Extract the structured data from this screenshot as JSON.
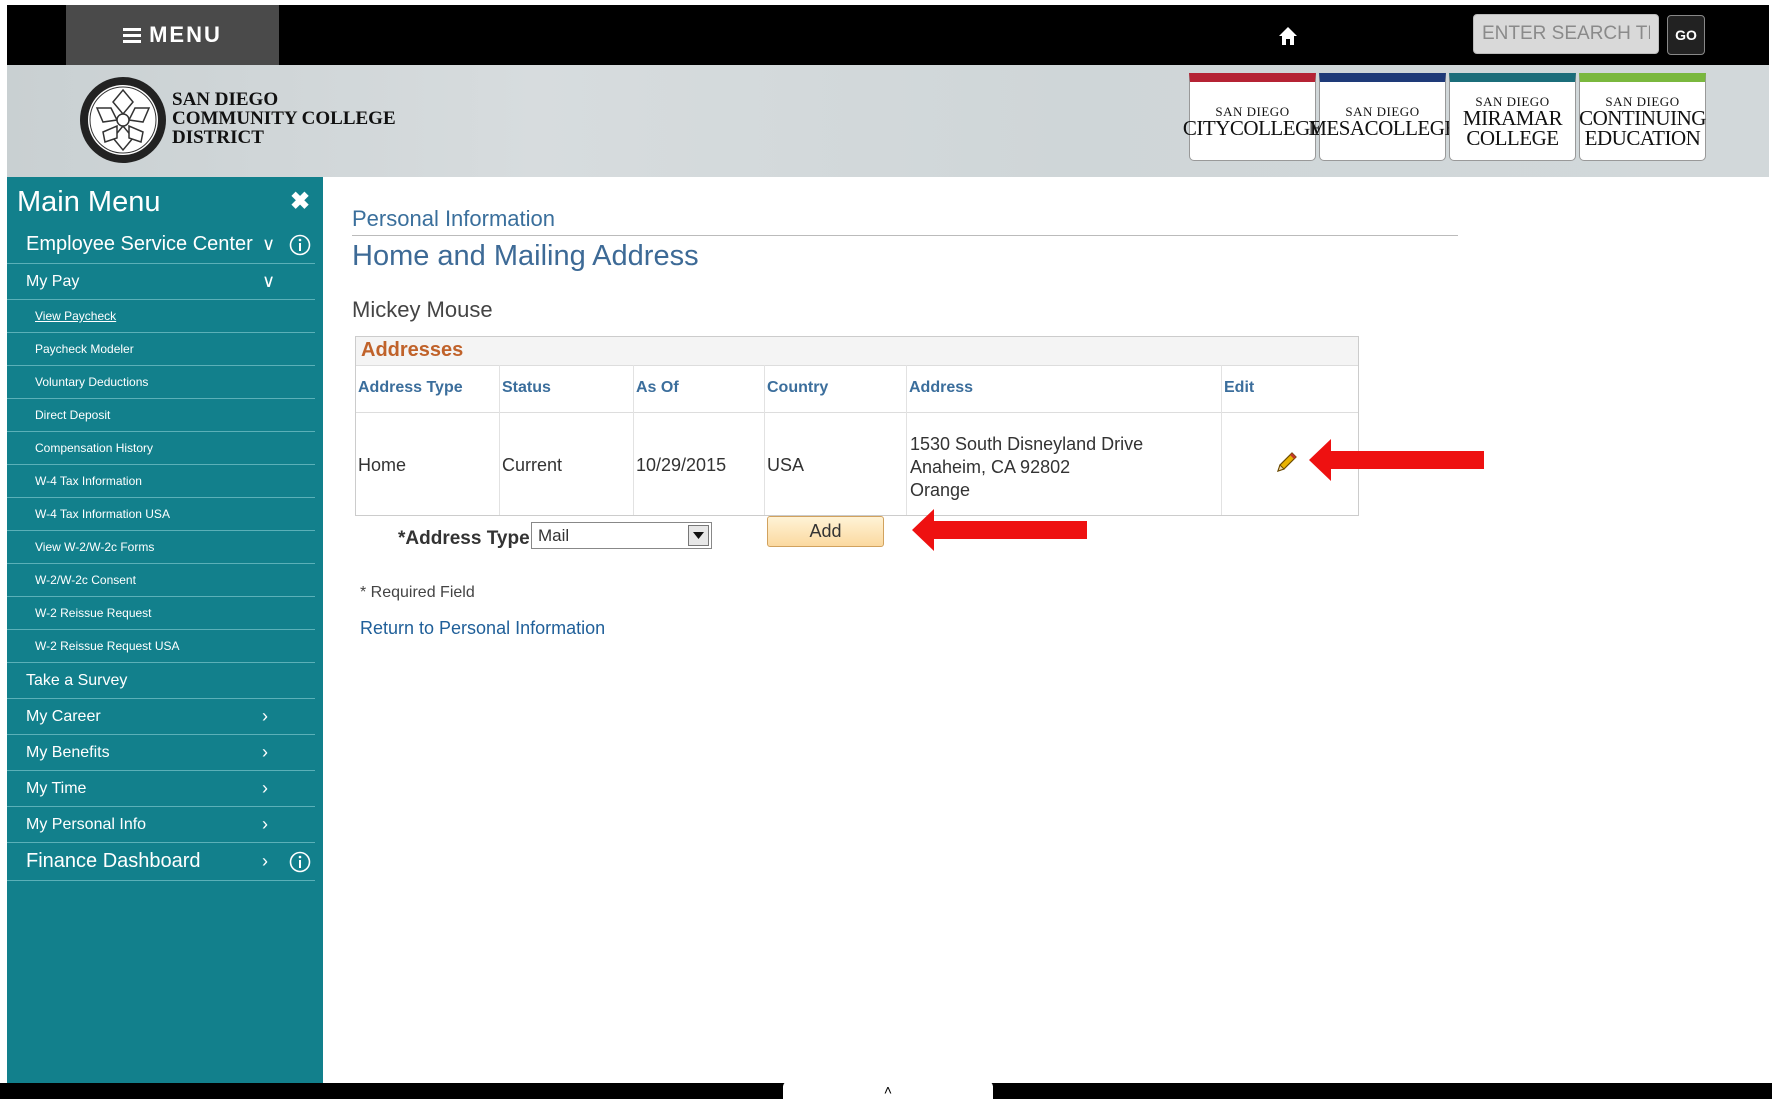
{
  "header": {
    "menu_label": "MENU",
    "search_placeholder": "ENTER SEARCH TERM",
    "go_label": "GO"
  },
  "banner": {
    "district": [
      "SAN DIEGO",
      "COMMUNITY COLLEGE",
      "DISTRICT"
    ],
    "colleges": [
      {
        "top": "SAN DIEGO",
        "main": [
          "CITYCOLLEGE"
        ],
        "color": "#b52334"
      },
      {
        "top": "SAN DIEGO",
        "main": [
          "MESACOLLEGE"
        ],
        "color": "#1e3a78"
      },
      {
        "top": "SAN DIEGO",
        "main": [
          "MIRAMAR",
          "COLLEGE"
        ],
        "color": "#1b6d7a"
      },
      {
        "top": "SAN DIEGO",
        "main": [
          "CONTINUING",
          "EDUCATION"
        ],
        "color": "#7ab83e"
      }
    ]
  },
  "sidebar": {
    "title": "Main Menu",
    "sections": [
      "Employee Service Center",
      "Finance Dashboard"
    ],
    "my_pay": "My Pay",
    "sub_items": [
      "View Paycheck",
      "Paycheck Modeler",
      "Voluntary Deductions",
      "Direct Deposit",
      "Compensation History",
      "W-4 Tax Information",
      "W-4 Tax Information USA",
      "View W-2/W-2c Forms",
      "W-2/W-2c Consent",
      "W-2 Reissue Request",
      "W-2 Reissue Request USA"
    ],
    "take_survey": "Take a Survey",
    "groups": [
      "My Career",
      "My Benefits",
      "My Time",
      "My Personal Info"
    ]
  },
  "content": {
    "breadcrumb": "Personal Information",
    "title": "Home and Mailing Address",
    "person": "Mickey Mouse",
    "addresses": {
      "heading": "Addresses",
      "columns": [
        "Address Type",
        "Status",
        "As Of",
        "Country",
        "Address",
        "Edit"
      ],
      "row": {
        "type": "Home",
        "status": "Current",
        "as_of": "10/29/2015",
        "country": "USA",
        "address_lines": [
          "1530 South Disneyland Drive",
          "Anaheim, CA 92802",
          "Orange"
        ]
      }
    },
    "address_type_label": "*Address Type",
    "address_type_value": "Mail",
    "add_label": "Add",
    "required_note": "* Required Field",
    "return_link": "Return to Personal Information"
  },
  "colors": {
    "sidebar": "#12808c",
    "accent_heading": "#c0622a",
    "link": "#1f5f99",
    "arrow": "#ee1111"
  }
}
